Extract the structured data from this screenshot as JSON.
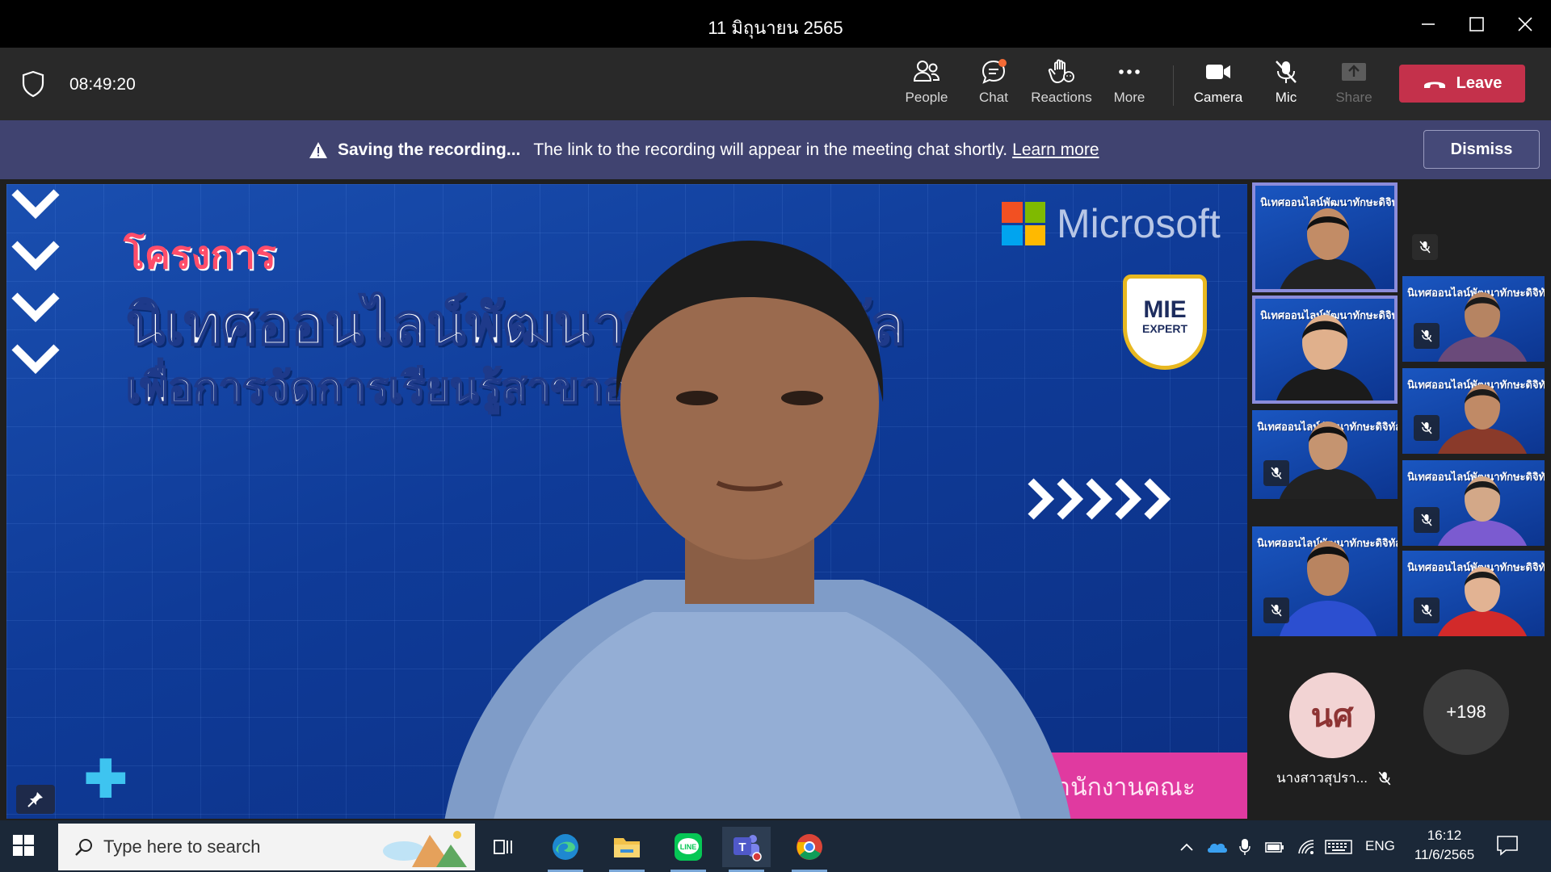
{
  "window": {
    "title": "11 มิถุนายน 2565"
  },
  "toolbar": {
    "timer": "08:49:20",
    "people_label": "People",
    "chat_label": "Chat",
    "reactions_label": "Reactions",
    "more_label": "More",
    "camera_label": "Camera",
    "mic_label": "Mic",
    "share_label": "Share",
    "leave_label": "Leave"
  },
  "banner": {
    "title": "Saving the recording...",
    "message": "The link to the recording will appear in the meeting chat shortly.",
    "link": "Learn more",
    "dismiss_label": "Dismiss"
  },
  "slide": {
    "line1": "โครงการ",
    "line2": "นิเทศออนไลน์พัฒนาทักษะดิจิทัล",
    "line3": "เพื่อการจัดการเรียนรู้สาขาอาชีวศึกษา",
    "brand": "Microsoft",
    "badge_top": "MIE",
    "badge_bottom": "EXPERT",
    "footer": "สำนักงานคณะกรรมการอาชีวศึกษา"
  },
  "gallery": {
    "tile_caption": "นิเทศออนไลน์พัฒนาทักษะดิจิทัล",
    "avatar_initials": "นศ",
    "avatar_name": "นางสาวสุปรา...",
    "overflow_count": "+198"
  },
  "taskbar": {
    "search_placeholder": "Type here to search",
    "language": "ENG",
    "time": "16:12",
    "date": "11/6/2565"
  },
  "colors": {
    "leave": "#c4314b",
    "banner": "#404370",
    "active_speaker": "#8b8cdb"
  }
}
